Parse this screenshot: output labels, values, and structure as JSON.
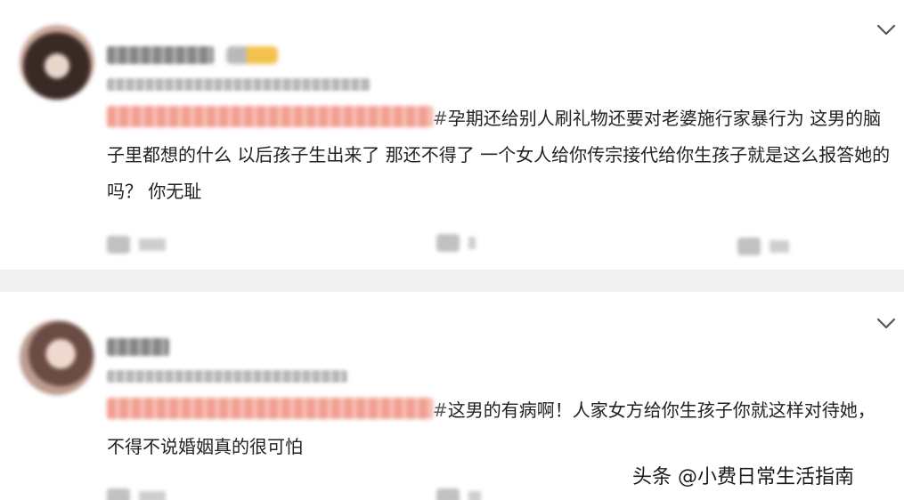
{
  "comments": [
    {
      "tag": "#",
      "text": "孕期还给别人刷礼物还要对老婆施行家暴行为 这男的脑子里都想的什么 以后孩子生出来了 那还不得了 一个女人给你传宗接代给你生孩子就是这么报答她的吗？ 你无耻"
    },
    {
      "tag": "#",
      "text": "这男的有病啊！人家女方给你生孩子你就这样对待她，不得不说婚姻真的很可怕"
    }
  ],
  "watermark": "头条 @小费日常生活指南",
  "icons": {
    "more": "chevron-down-icon",
    "comment": "comment-icon",
    "repost": "repost-icon",
    "like": "thumbs-up-icon"
  }
}
